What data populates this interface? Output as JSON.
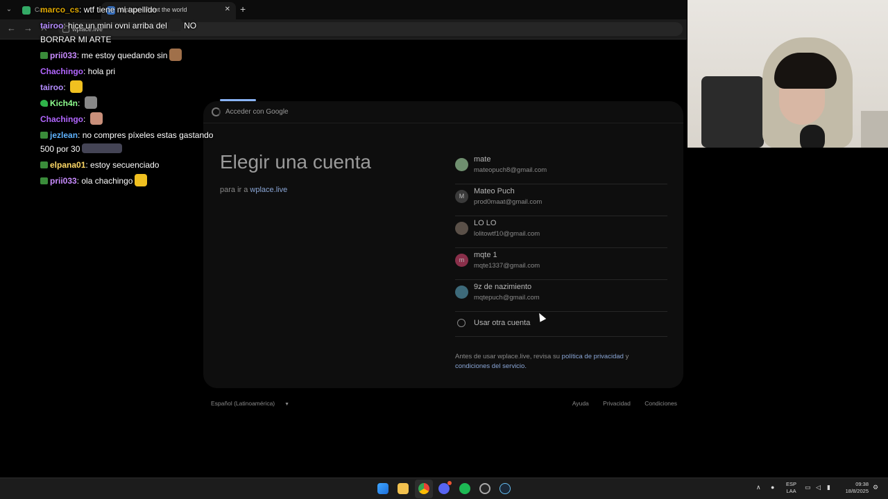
{
  "browser": {
    "tab1_title": "Ca...",
    "tab2_title": "Wplace - Paint the world",
    "url": "wplace.live"
  },
  "google": {
    "header": "Acceder con Google",
    "title": "Elegir una cuenta",
    "subtitle_prefix": "para ir a",
    "subtitle_link": "wplace.live",
    "accounts": [
      {
        "name": "mate",
        "email": "mateopuch8@gmail.com",
        "avatar_letter": "",
        "avatar_color": "#6f8f6f"
      },
      {
        "name": "Mateo Puch",
        "email": "prod0maat@gmail.com",
        "avatar_letter": "M",
        "avatar_color": "#3a3a3a"
      },
      {
        "name": "LO LO",
        "email": "lolitowtf10@gmail.com",
        "avatar_letter": "",
        "avatar_color": "#5a5048"
      },
      {
        "name": "mqte 1",
        "email": "mqte1337@gmail.com",
        "avatar_letter": "m",
        "avatar_color": "#8a2f4a"
      },
      {
        "name": "9z de nazimiento",
        "email": "mqtepuch@gmail.com",
        "avatar_letter": "",
        "avatar_color": "#3d6a7a"
      }
    ],
    "other_account": "Usar otra cuenta",
    "policy_prefix": "Antes de usar wplace.live, revisa su",
    "policy_link1": "política de privacidad",
    "policy_and": "y",
    "policy_link2": "condiciones del servicio",
    "policy_end": ".",
    "footer_language": "Español (Latinoamérica)",
    "footer_links": [
      "Ayuda",
      "Privacidad",
      "Condiciones"
    ]
  },
  "chat": [
    {
      "user": "marco_cs",
      "color": "#e0a800",
      "text": "wtf tiene mi apellido",
      "badge": "none",
      "emote": ""
    },
    {
      "user": "tairoo",
      "color": "#b48cff",
      "text": "hice un mini ovni arriba del",
      "text2": "NO BORRAR MI ARTE",
      "badge": "none",
      "emote": "dark"
    },
    {
      "user": "prii033",
      "color": "#c98cff",
      "text": "me estoy quedando sin",
      "badge": "sub",
      "emote": "brown"
    },
    {
      "user": "Chachingo",
      "color": "#b266ff",
      "text": "hola pri",
      "badge": "none",
      "emote": ""
    },
    {
      "user": "tairoo",
      "color": "#b48cff",
      "text": "",
      "badge": "none",
      "emote": "yellow"
    },
    {
      "user": "Kich4n",
      "color": "#8fff8f",
      "text": "",
      "badge": "clover",
      "emote": "gray"
    },
    {
      "user": "Chachingo",
      "color": "#b266ff",
      "text": "",
      "badge": "none",
      "emote": "face"
    },
    {
      "user": "jezlean",
      "color": "#5fb3ff",
      "text": "no compres píxeles estas gastando 500 por 30",
      "badge": "sub",
      "emote": "wide"
    },
    {
      "user": "elpana01",
      "color": "#ffd966",
      "text": "estoy secuenciado",
      "badge": "sub",
      "emote": ""
    },
    {
      "user": "prii033",
      "color": "#c98cff",
      "text": "ola chachingo",
      "badge": "sub",
      "emote": "yellow"
    }
  ],
  "taskbar": {
    "lang_line1": "ESP",
    "lang_line2": "LAA",
    "time": "09:38",
    "date": "18/8/2025",
    "discord_badge": "20"
  }
}
